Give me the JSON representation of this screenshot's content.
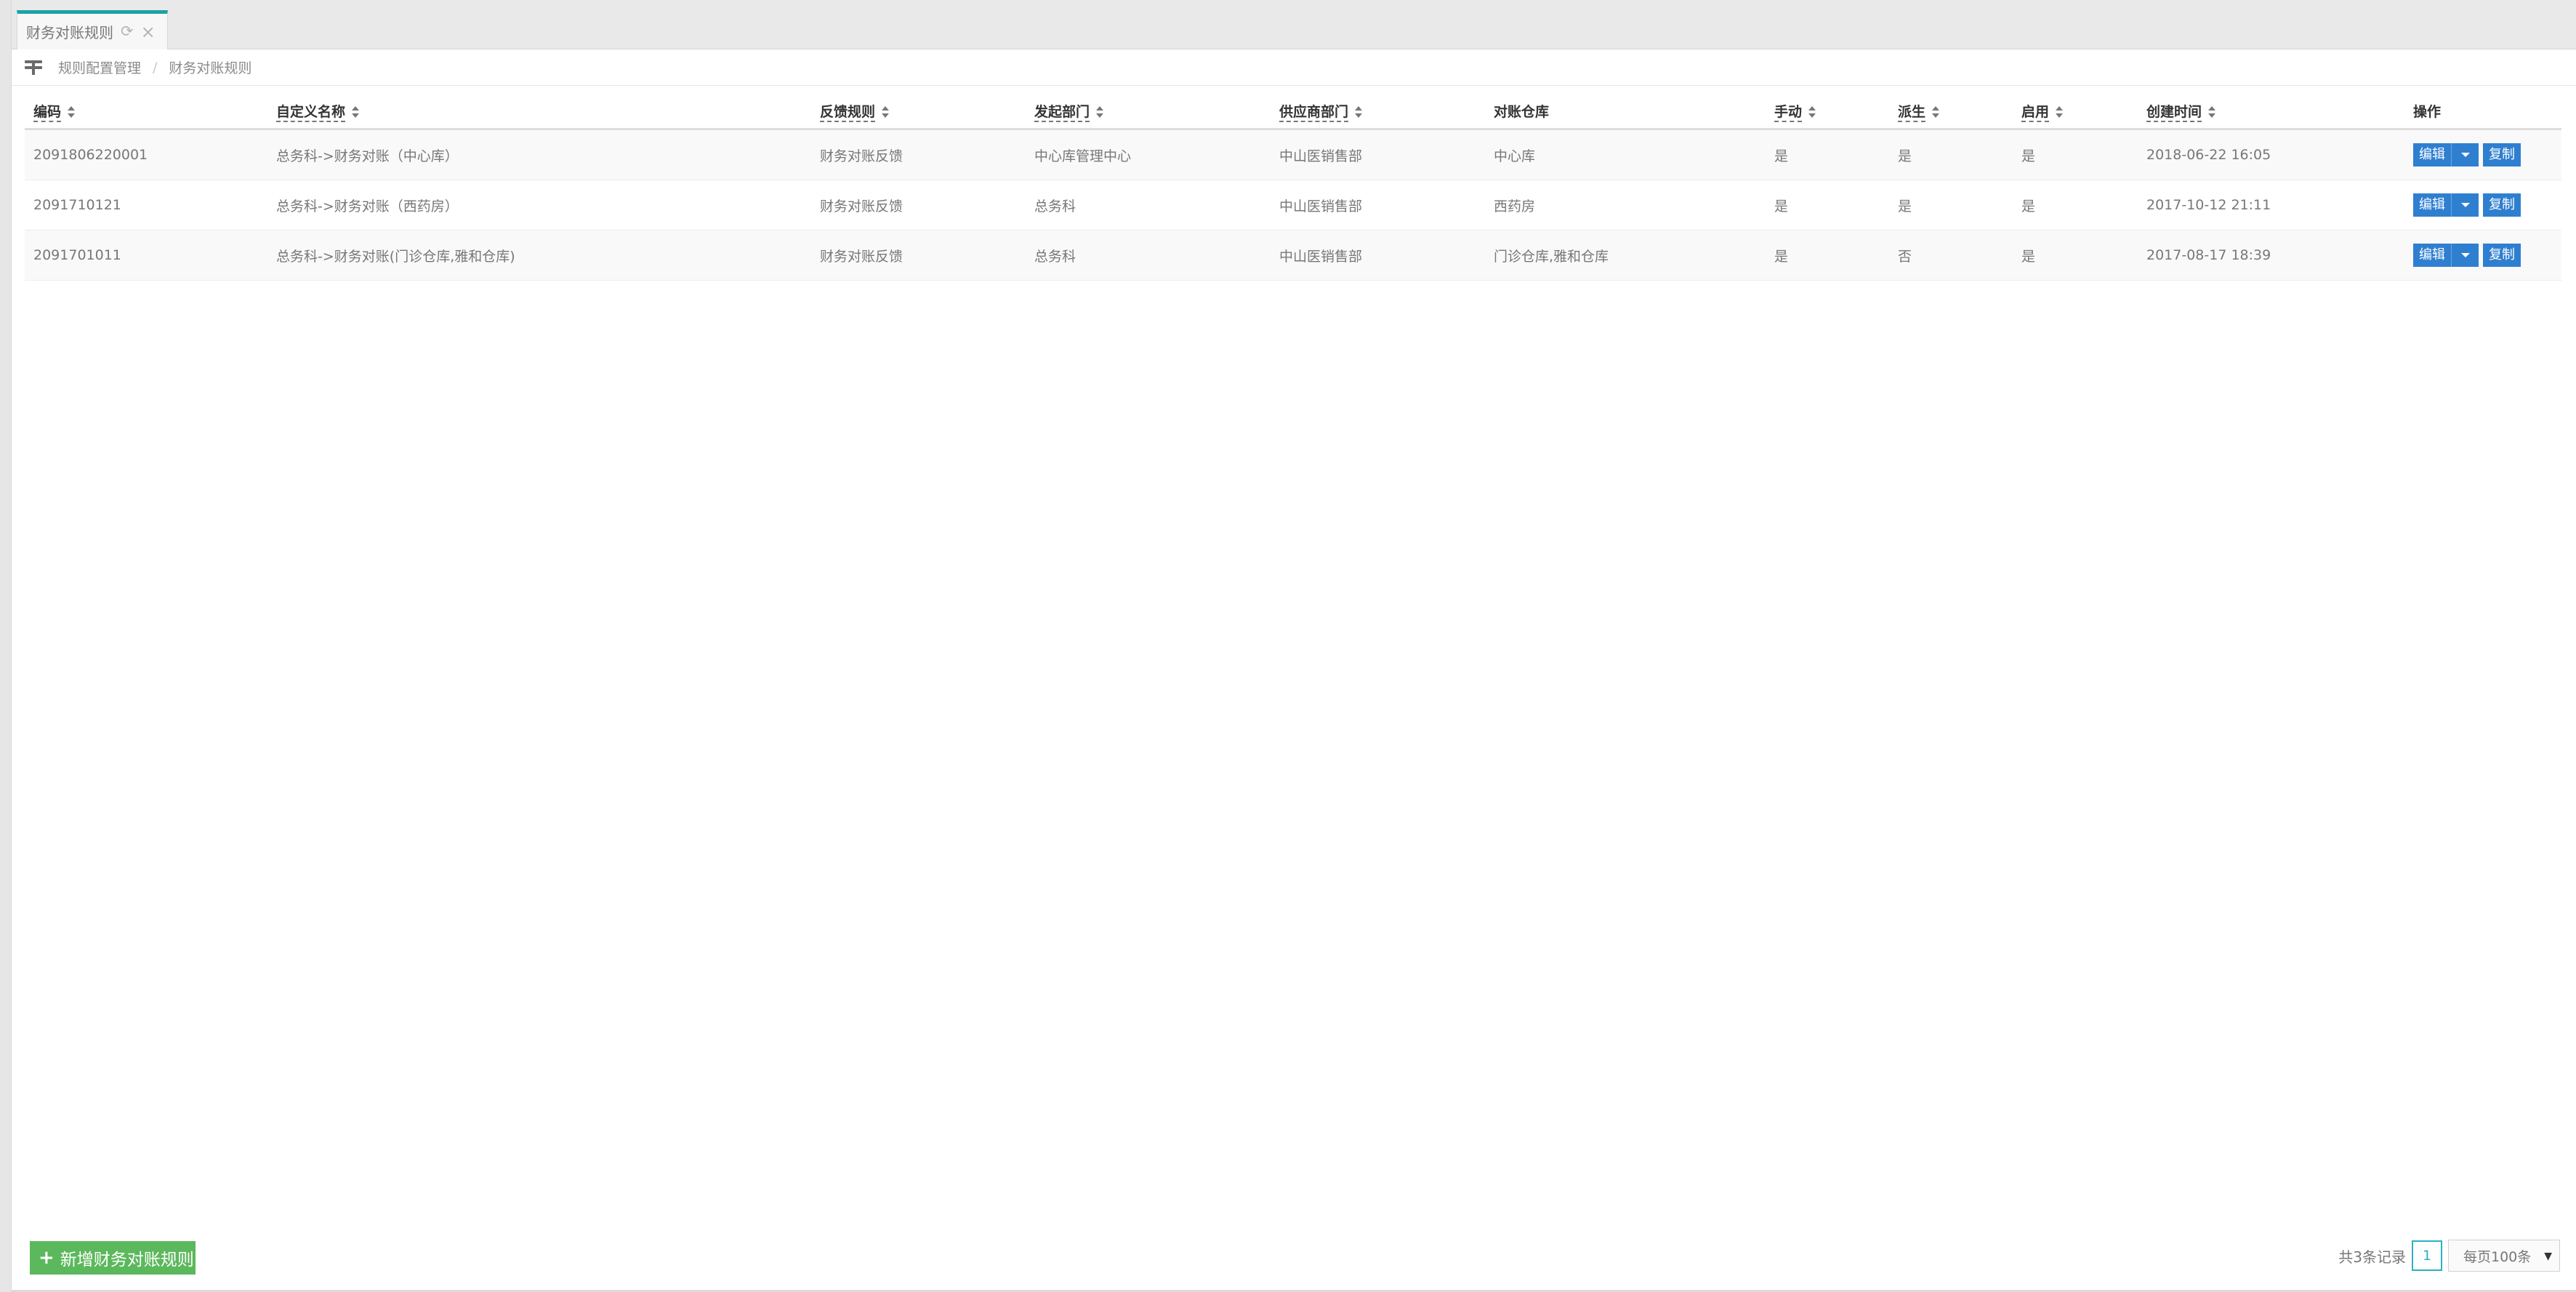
{
  "tab": {
    "title": "财务对账规则",
    "refresh_icon": "refresh-icon",
    "close_icon": "close-icon"
  },
  "breadcrumb": {
    "items": [
      "规则配置管理",
      "财务对账规则"
    ],
    "separator": "/"
  },
  "table": {
    "columns": [
      "编码",
      "自定义名称",
      "反馈规则",
      "发起部门",
      "供应商部门",
      "对账仓库",
      "手动",
      "派生",
      "启用",
      "创建时间",
      "操作"
    ],
    "rows": [
      {
        "code": "2091806220001",
        "name": "总务科->财务对账（中心库）",
        "rule": "财务对账反馈",
        "origin_dept": "中心库管理中心",
        "supplier_dept": "中山医销售部",
        "warehouse": "中心库",
        "manual": "是",
        "derived": "是",
        "enabled": "是",
        "created": "2018-06-22 16:05"
      },
      {
        "code": "2091710121",
        "name": "总务科->财务对账（西药房）",
        "rule": "财务对账反馈",
        "origin_dept": "总务科",
        "supplier_dept": "中山医销售部",
        "warehouse": "西药房",
        "manual": "是",
        "derived": "是",
        "enabled": "是",
        "created": "2017-10-12 21:11"
      },
      {
        "code": "2091701011",
        "name": "总务科->财务对账(门诊仓库,雅和仓库)",
        "rule": "财务对账反馈",
        "origin_dept": "总务科",
        "supplier_dept": "中山医销售部",
        "warehouse": "门诊仓库,雅和仓库",
        "manual": "是",
        "derived": "否",
        "enabled": "是",
        "created": "2017-08-17 18:39"
      }
    ],
    "actions": {
      "edit": "编辑",
      "copy": "复制"
    }
  },
  "footer": {
    "add_button": "新增财务对账规则",
    "total": "共3条记录",
    "page": "1",
    "page_size": "每页100条"
  },
  "colors": {
    "accent": "#1aa3a3",
    "primary": "#2f7fd0",
    "success": "#5cb85c"
  }
}
